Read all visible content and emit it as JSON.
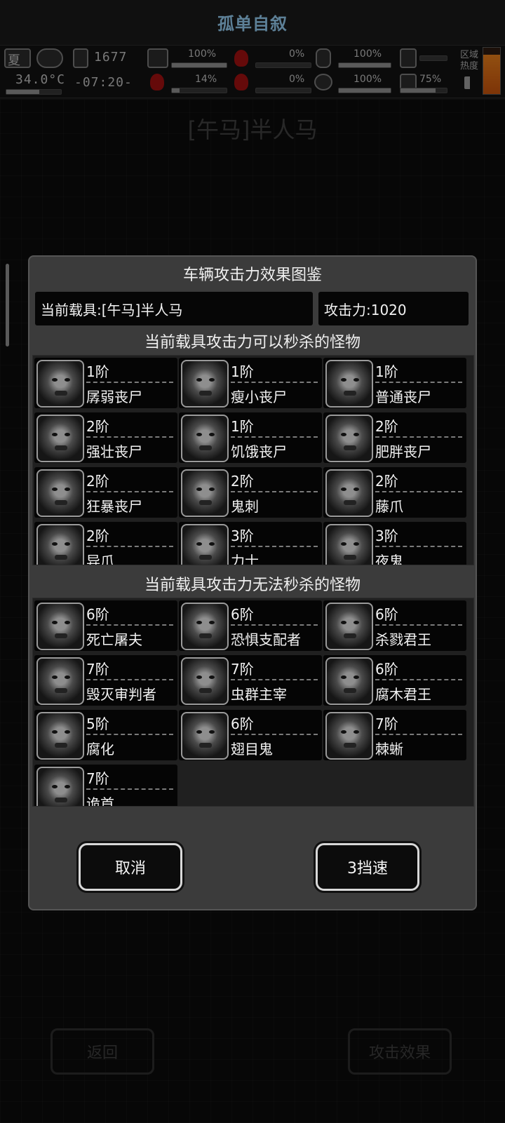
{
  "app_title": "孤单自叙",
  "status_bar": {
    "season": "夏",
    "temperature": "34.0°C",
    "day_counter": "1677",
    "clock": "-07:20-",
    "health_top": "100%",
    "health_bottom": "14%",
    "stat2_top": "0%",
    "stat2_bottom": "0%",
    "stat3_top": "100%",
    "stat3_bottom": "100%",
    "stat4_bottom": "75%",
    "zone_heat_label_1": "区域",
    "zone_heat_label_2": "热度",
    "levels": {
      "health_top": 1.0,
      "health_bottom": 0.14,
      "stat2_top": 0.0,
      "stat2_bottom": 0.0,
      "stat3_top": 1.0,
      "stat3_bottom": 1.0,
      "stat4_bottom": 0.75,
      "zone_heat": 0.85
    }
  },
  "background": {
    "vehicle_title": "[午马]半人马",
    "back_label": "返回",
    "attack_effect_label": "攻击效果"
  },
  "modal": {
    "title": "车辆攻击力效果图鉴",
    "current_vehicle": "当前载具:[午马]半人马",
    "attack_power": "攻击力:1020",
    "killable_title": "当前载具攻击力可以秒杀的怪物",
    "unkillable_title": "当前载具攻击力无法秒杀的怪物",
    "cancel_label": "取消",
    "confirm_label": "3挡速",
    "killable": [
      {
        "rank": "1阶",
        "name": "孱弱丧尸"
      },
      {
        "rank": "1阶",
        "name": "瘦小丧尸"
      },
      {
        "rank": "1阶",
        "name": "普通丧尸"
      },
      {
        "rank": "2阶",
        "name": "强壮丧尸"
      },
      {
        "rank": "1阶",
        "name": "饥饿丧尸"
      },
      {
        "rank": "2阶",
        "name": "肥胖丧尸"
      },
      {
        "rank": "2阶",
        "name": "狂暴丧尸"
      },
      {
        "rank": "2阶",
        "name": "鬼刺"
      },
      {
        "rank": "2阶",
        "name": "藤爪"
      },
      {
        "rank": "2阶",
        "name": "异爪"
      },
      {
        "rank": "3阶",
        "name": "力士"
      },
      {
        "rank": "3阶",
        "name": "夜鬼"
      }
    ],
    "unkillable": [
      {
        "rank": "6阶",
        "name": "死亡屠夫"
      },
      {
        "rank": "6阶",
        "name": "恐惧支配者"
      },
      {
        "rank": "6阶",
        "name": "杀戮君王"
      },
      {
        "rank": "7阶",
        "name": "毁灭审判者"
      },
      {
        "rank": "7阶",
        "name": "虫群主宰"
      },
      {
        "rank": "6阶",
        "name": "腐木君王"
      },
      {
        "rank": "5阶",
        "name": "腐化"
      },
      {
        "rank": "6阶",
        "name": "翅目鬼"
      },
      {
        "rank": "7阶",
        "name": "棘蜥"
      },
      {
        "rank": "7阶",
        "name": "诡首"
      }
    ]
  }
}
